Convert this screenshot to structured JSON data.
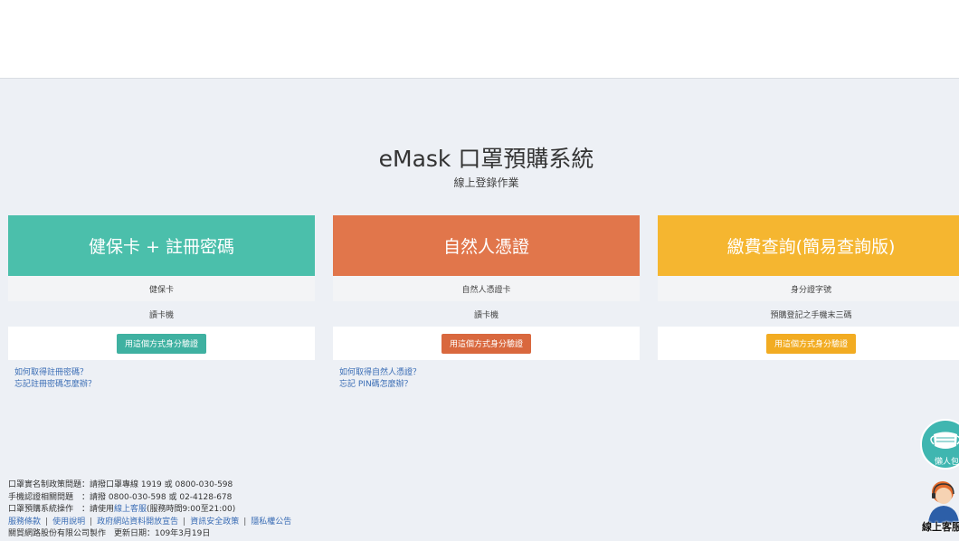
{
  "header": {
    "title": "eMask 口罩預購系統",
    "subtitle": "線上登錄作業"
  },
  "cards": [
    {
      "title": "健保卡 + 註冊密碼",
      "row1": "健保卡",
      "row2": "讀卡機",
      "button": "用這個方式身分驗證",
      "color": "#4bbfab",
      "button_color": "#3fb1a1",
      "links": [
        "如何取得註冊密碼？",
        "忘記註冊密碼怎麼辦？"
      ]
    },
    {
      "title": "自然人憑證",
      "row1": "自然人憑證卡",
      "row2": "讀卡機",
      "button": "用這個方式身分驗證",
      "color": "#e1764b",
      "button_color": "#d9683e",
      "links": [
        "如何取得自然人憑證？",
        "忘記 PIN碼怎麼辦？"
      ]
    },
    {
      "title": "繳費查詢(簡易查詢版)",
      "row1": "身分證字號",
      "row2": "預購登記之手機末三碼",
      "button": "用這個方式身分驗證",
      "color": "#f5b630",
      "button_color": "#f2ac22",
      "links": []
    }
  ],
  "footer": {
    "line1": "口罩實名制政策問題：請撥口罩專線 1919 或 0800-030-598",
    "line2": "手機認證相關問題　：請撥 0800-030-598 或 02-4128-678",
    "line3_prefix": "口罩預購系統操作　：請使用",
    "line3_link": "線上客服",
    "line3_suffix": "(服務時間9:00至21:00)",
    "links": [
      "服務條款",
      "使用說明",
      "政府網站資料開放宣告",
      "資訊安全政策",
      "隱私權公告"
    ],
    "credit": "關貿網路股份有限公司製作　更新日期：109年3月19日"
  },
  "floating": {
    "info_pack": "懶人包",
    "online_service": "線上客服"
  },
  "icons": {
    "info_pack": "mask-icon",
    "online_service": "service-agent-icon"
  }
}
